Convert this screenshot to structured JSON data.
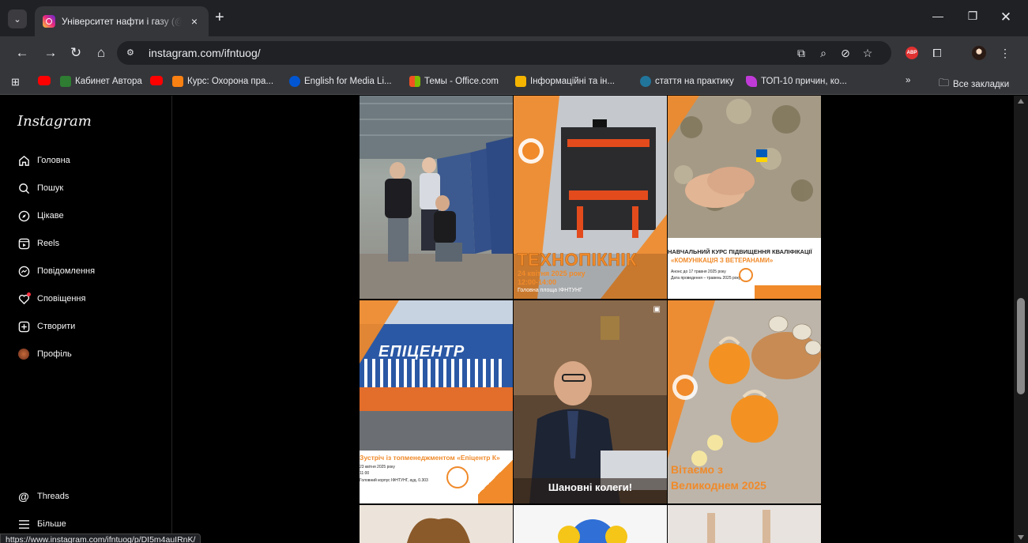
{
  "browser": {
    "tab_title": "Університет нафти і газу (@ifntuog)",
    "tab_close": "×",
    "new_tab": "+",
    "url": "instagram.com/ifntuog/",
    "status_url": "https://www.instagram.com/ifntuog/p/DI5m4auIRnK/"
  },
  "bookmarks": [
    {
      "label": "Кабинет Автора",
      "icon": "five-icon",
      "color": "#2e7d32"
    },
    {
      "label": "Курс: Охорона пра...",
      "icon": "moodle-icon",
      "color": "#f98012"
    },
    {
      "label": "English for Media Li...",
      "icon": "coursera-icon",
      "color": "#0056d2"
    },
    {
      "label": "Темы - Office.com",
      "icon": "office-icon",
      "color": "#ea3e23"
    },
    {
      "label": "Інформаційні та ін...",
      "icon": "folder-page-icon",
      "color": "#f4b400"
    },
    {
      "label": "стаття на практику",
      "icon": "wordpress-icon",
      "color": "#21759b"
    },
    {
      "label": "ТОП-10 причин, ко...",
      "icon": "feather-icon",
      "color": "#c03ad8"
    }
  ],
  "bookmarks_all": "Все закладки",
  "sidebar": {
    "logo": "Instagram",
    "items": [
      {
        "label": "Головна",
        "icon": "home-icon"
      },
      {
        "label": "Пошук",
        "icon": "search-icon"
      },
      {
        "label": "Цікаве",
        "icon": "compass-icon"
      },
      {
        "label": "Reels",
        "icon": "reels-icon"
      },
      {
        "label": "Повідомлення",
        "icon": "messenger-icon"
      },
      {
        "label": "Сповіщення",
        "icon": "heart-icon"
      },
      {
        "label": "Створити",
        "icon": "plus-square-icon"
      },
      {
        "label": "Профіль",
        "icon": "avatar"
      }
    ],
    "threads": "Threads",
    "more": "Більше"
  },
  "posts": {
    "tech_title": "ТЕХНОПІКНІК",
    "tech_date": "24 квітня 2025 року",
    "tech_time": "12:00-14:00",
    "tech_place": "Головна площа ІФНТУНГ",
    "course_title": "НАВЧАЛЬНИЙ КУРС ПІДВИЩЕННЯ КВАЛІФІКАЦІЇ",
    "course_sub": "«КОМУНІКАЦІЯ З ВЕТЕРАНАМИ»",
    "course_line1": "Анонс до 17 травня 2025 року",
    "course_line2": "Дата проведення – травень 2025 року",
    "epicentr_sign": "ЕПІЦЕНТР",
    "epicentr_title": "Зустріч із топменеджментом «Епіцентр К»",
    "epicentr_date": "23 квітня 2025 року",
    "epicentr_time": "11:00",
    "epicentr_place": "Головний корпус ІФНТУНГ, ауд. 0.303",
    "colleagues": "Шановні колеги!",
    "easter_1": "Вітаємо з",
    "easter_2": "Великоднем 2025"
  },
  "colors": {
    "accent": "#f08a2a",
    "ig_notification": "#ff3040"
  }
}
